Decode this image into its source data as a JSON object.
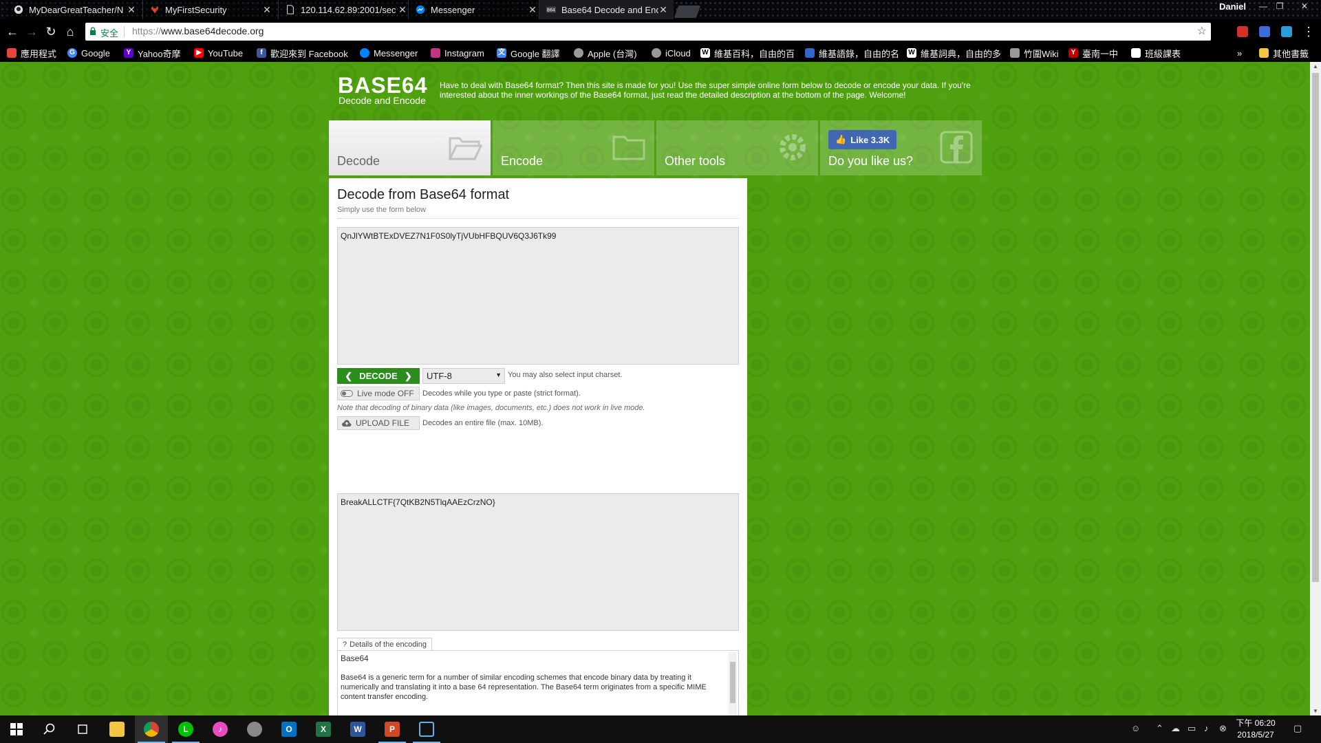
{
  "browser": {
    "tabs": [
      {
        "title": "MyDearGreatTeacher/N",
        "icon": "github-icon",
        "active": false
      },
      {
        "title": "MyFirstSecurity",
        "icon": "gitlab-icon",
        "active": false
      },
      {
        "title": "120.114.62.89:2001/sec",
        "icon": "document-icon",
        "active": false
      },
      {
        "title": "Messenger",
        "icon": "messenger-icon",
        "active": false
      },
      {
        "title": "Base64 Decode and Enc",
        "icon": "base64-favicon",
        "active": true
      }
    ],
    "profile_name": "Daniel",
    "window_controls": {
      "minimize": "—",
      "restore": "❐",
      "close": "✕"
    },
    "omnibox": {
      "secure_label": "安全",
      "url_scheme": "https://",
      "url_host": "www.base64decode.org"
    },
    "bookmarks": [
      {
        "label": "應用程式",
        "icon": "apps-grid-icon",
        "color": "#e8453c"
      },
      {
        "label": "Google",
        "icon": "google-icon",
        "color": "#4285f4"
      },
      {
        "label": "Yahoo奇摩",
        "icon": "yahoo-icon",
        "color": "#5f01d1"
      },
      {
        "label": "YouTube",
        "icon": "youtube-icon",
        "color": "#ff0000"
      },
      {
        "label": "歡迎來到 Facebook",
        "icon": "facebook-icon",
        "color": "#3b5998"
      },
      {
        "label": "Messenger",
        "icon": "messenger-icon",
        "color": "#0084ff"
      },
      {
        "label": "Instagram",
        "icon": "instagram-icon",
        "color": "#c13584"
      },
      {
        "label": "Google 翻譯",
        "icon": "translate-icon",
        "color": "#4285f4"
      },
      {
        "label": "Apple (台灣)",
        "icon": "apple-icon",
        "color": "#999999"
      },
      {
        "label": "iCloud",
        "icon": "apple-icon",
        "color": "#999999"
      },
      {
        "label": "維基百科，自由的百",
        "icon": "wikipedia-icon",
        "color": "#ffffff"
      },
      {
        "label": "維基語錄，自由的名",
        "icon": "wikiquote-icon",
        "color": "#3366cc"
      },
      {
        "label": "維基詞典，自由的多",
        "icon": "wiktionary-icon",
        "color": "#ffffff"
      },
      {
        "label": "竹圍Wiki",
        "icon": "wiki-icon",
        "color": "#999999"
      },
      {
        "label": "臺南一中",
        "icon": "school-icon",
        "color": "#c00000"
      },
      {
        "label": "班級課表",
        "icon": "page-icon",
        "color": "#ffffff"
      }
    ],
    "bookmarks_overflow": "»",
    "other_bookmarks": "其他書籤"
  },
  "site": {
    "logo_title": "BASE64",
    "logo_subtitle": "Decode and Encode",
    "intro": "Have to deal with Base64 format? Then this site is made for you! Use the super simple online form below to decode or encode your data. If you're interested about the inner workings of the Base64 format, just read the detailed description at the bottom of the page. Welcome!",
    "tabs": {
      "decode": "Decode",
      "encode": "Encode",
      "other": "Other tools",
      "like_question": "Do you like us?",
      "like_button": "Like 3.3K"
    }
  },
  "panel": {
    "title": "Decode from Base64 format",
    "subtitle": "Simply use the form below",
    "input_value": "QnJlYWtBTExDVEZ7N1F0S0lyTjVUbHFBQUV6Q3J6Tk99",
    "decode_button": "DECODE",
    "charset": "UTF-8",
    "charset_note": "You may also select input charset.",
    "live_mode": "Live mode OFF",
    "live_note": "Decodes while you type or paste (strict format).",
    "binary_note": "Note that decoding of binary data (like images, documents, etc.) does not work in live mode.",
    "upload_button": "UPLOAD FILE",
    "upload_note": "Decodes an entire file (max. 10MB).",
    "output_value": "BreakALLCTF{7QtKB2N5TlqAAEzCrzNO}",
    "details_tab": "Details of the encoding",
    "details_heading": "Base64",
    "details_text": "Base64 is a generic term for a number of similar encoding schemes that encode binary data by treating it numerically and translating it into a base 64 representation. The Base64 term originates from a specific MIME content transfer encoding."
  },
  "taskbar": {
    "apps": [
      {
        "name": "start",
        "icon": "windows-icon"
      },
      {
        "name": "search",
        "icon": "search-icon"
      },
      {
        "name": "task-view",
        "icon": "task-view-icon"
      },
      {
        "name": "file-explorer",
        "icon": "folder-icon",
        "color": "#f4c542"
      },
      {
        "name": "chrome",
        "icon": "chrome-icon",
        "color": "#db4437",
        "running": true
      },
      {
        "name": "line",
        "icon": "line-icon",
        "color": "#00c300"
      },
      {
        "name": "itunes",
        "icon": "itunes-icon",
        "color": "#ea4cc0"
      },
      {
        "name": "network-app",
        "icon": "globe-icon",
        "color": "#888888"
      },
      {
        "name": "outlook",
        "icon": "outlook-icon",
        "color": "#0072c6"
      },
      {
        "name": "excel",
        "icon": "excel-icon",
        "color": "#217346"
      },
      {
        "name": "word",
        "icon": "word-icon",
        "color": "#2b579a"
      },
      {
        "name": "powerpoint",
        "icon": "powerpoint-icon",
        "color": "#d24726"
      },
      {
        "name": "3d-viewer",
        "icon": "cube-icon",
        "color": "#5fb3e8"
      }
    ],
    "time": "下午 06:20",
    "date": "2018/5/27"
  }
}
